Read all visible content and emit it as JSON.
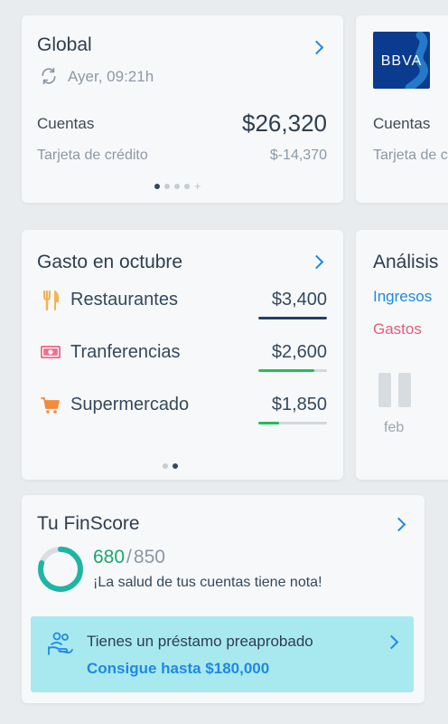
{
  "global": {
    "title": "Global",
    "sync_text": "Ayer, 09:21h",
    "accounts_label": "Cuentas",
    "accounts_value": "$26,320",
    "credit_label": "Tarjeta de crédito",
    "credit_value": "$-14,370",
    "plus_glyph": "+"
  },
  "bank": {
    "logo_text": "BBVA",
    "accounts_label": "Cuentas",
    "credit_label": "Tarjeta de crédito",
    "logo_color": "#0a3b8f"
  },
  "spending": {
    "title": "Gasto en octubre",
    "items": [
      {
        "icon": "fork-knife-icon",
        "label": "Restaurantes",
        "amount": "$3,400",
        "fill": 1.0,
        "color": "#233f6b"
      },
      {
        "icon": "money-icon",
        "label": "Tranferencias",
        "amount": "$2,600",
        "fill": 0.82,
        "color": "#1fbf5a"
      },
      {
        "icon": "cart-icon",
        "label": "Supermercado",
        "amount": "$1,850",
        "fill": 0.3,
        "color": "#1fbf5a"
      }
    ]
  },
  "analysis": {
    "title": "Análisis",
    "income_label": "Ingresos",
    "expenses_label": "Gastos",
    "month_label": "feb",
    "income_color": "#1e88e5",
    "expenses_color": "#e35d7a"
  },
  "finscore": {
    "title": "Tu FinScore",
    "score": "680",
    "separator": "/",
    "max": "850",
    "score_fraction": 0.8,
    "message": "¡La salud de tus cuentas tiene nota!",
    "score_color": "#1aa76f"
  },
  "loan": {
    "text": "Tienes un préstamo preaprobado",
    "cta": "Consigue hasta $180,000",
    "background": "#a8e9ef"
  }
}
